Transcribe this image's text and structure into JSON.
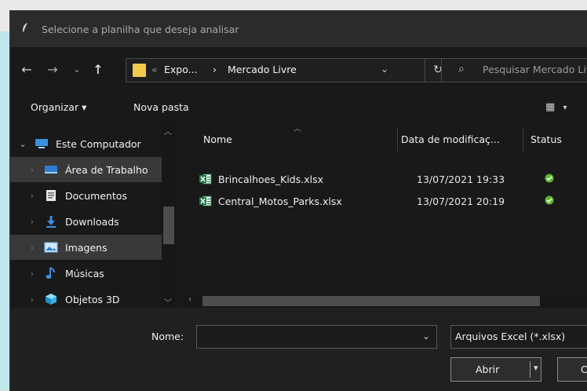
{
  "window": {
    "title": "Selecione a planilha que deseja analisar"
  },
  "address": {
    "prefix": "«",
    "crumb1": "Expo...",
    "sep": "›",
    "crumb2": "Mercado Livre"
  },
  "search": {
    "placeholder": "Pesquisar Mercado Livre"
  },
  "toolbar": {
    "organize_label": "Organizar ▾",
    "new_folder_label": "Nova pasta"
  },
  "nav": {
    "items": [
      {
        "label": "Este Computador",
        "icon": "computer-icon"
      },
      {
        "label": "Área de Trabalho",
        "icon": "desktop-icon"
      },
      {
        "label": "Documentos",
        "icon": "documents-icon"
      },
      {
        "label": "Downloads",
        "icon": "downloads-icon"
      },
      {
        "label": "Imagens",
        "icon": "pictures-icon"
      },
      {
        "label": "Músicas",
        "icon": "music-icon"
      },
      {
        "label": "Objetos 3D",
        "icon": "3d-objects-icon"
      }
    ]
  },
  "columns": {
    "name": "Nome",
    "date": "Data de modificaç...",
    "status": "Status"
  },
  "files": [
    {
      "name": "Brincalhoes_Kids.xlsx",
      "date": "13/07/2021 19:33",
      "status": "synced"
    },
    {
      "name": "Central_Motos_Parks.xlsx",
      "date": "13/07/2021 20:19",
      "status": "synced"
    }
  ],
  "footer": {
    "name_label": "Nome:",
    "name_value": "",
    "filter_label": "Arquivos Excel (*.xlsx)",
    "open_label": "Abrir",
    "cancel_label": "C"
  },
  "colors": {
    "accent_folder": "#f2c94c",
    "status_green": "#5fb832",
    "excel_green": "#1f7a45"
  }
}
